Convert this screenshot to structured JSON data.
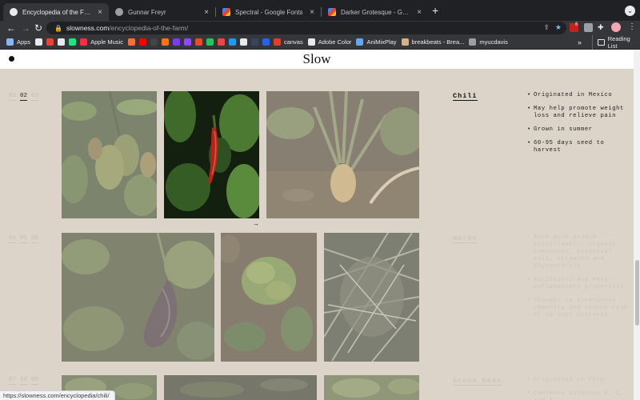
{
  "browser": {
    "tabs": [
      {
        "title": "Encyclopedia of the Farm – Slow",
        "favicon": "globe-icon",
        "active": true
      },
      {
        "title": "Gunnar Freyr",
        "favicon": "globe-icon",
        "active": false
      },
      {
        "title": "Spectral - Google Fonts",
        "favicon": "google-fonts-icon",
        "active": false
      },
      {
        "title": "Darker Grotesque - Google Fonts",
        "favicon": "google-fonts-icon",
        "active": false
      }
    ],
    "new_tab": "+",
    "url_host": "slowness.com",
    "url_path": "/encyclopedia-of-the-farm/",
    "extension_badge": "6",
    "bookmarks": [
      {
        "label": "Apps",
        "icon": "apps-grid-icon",
        "color": "#8ab4f8"
      },
      {
        "label": "",
        "icon": "google-icon",
        "color": "#e8eaed"
      },
      {
        "label": "",
        "icon": "gmail-icon",
        "color": "#ea4335"
      },
      {
        "label": "",
        "icon": "bookmark-icon",
        "color": "#e8eaed"
      },
      {
        "label": "",
        "icon": "hulu-icon",
        "color": "#1ce783"
      },
      {
        "label": "Apple Music",
        "icon": "apple-music-icon",
        "color": "#fa2d48"
      },
      {
        "label": "",
        "icon": "bookmark-icon",
        "color": "#ff6f3c"
      },
      {
        "label": "",
        "icon": "youtube-icon",
        "color": "#ff0000"
      },
      {
        "label": "",
        "icon": "bookmark-icon",
        "color": "#444"
      },
      {
        "label": "",
        "icon": "bookmark-icon",
        "color": "#f97316"
      },
      {
        "label": "",
        "icon": "bookmark-icon",
        "color": "#7c3aed"
      },
      {
        "label": "",
        "icon": "bookmark-icon",
        "color": "#9146ff"
      },
      {
        "label": "",
        "icon": "bookmark-icon",
        "color": "#e44d26"
      },
      {
        "label": "",
        "icon": "bookmark-icon",
        "color": "#22c55e"
      },
      {
        "label": "",
        "icon": "bookmark-icon",
        "color": "#ef4444"
      },
      {
        "label": "",
        "icon": "bookmark-icon",
        "color": "#1d9bf0"
      },
      {
        "label": "",
        "icon": "amazon-icon",
        "color": "#e8eaed"
      },
      {
        "label": "",
        "icon": "tumblr-icon",
        "color": "#36465d"
      },
      {
        "label": "",
        "icon": "bookmark-icon",
        "color": "#2563eb"
      },
      {
        "label": "canvas",
        "icon": "canvas-icon",
        "color": "#e13f2b"
      },
      {
        "label": "Adobe Color",
        "icon": "adobe-color-icon",
        "color": "#e8eaed"
      },
      {
        "label": "AniMixPlay",
        "icon": "play-icon",
        "color": "#5fa8ff"
      },
      {
        "label": "breakbeats - Brea...",
        "icon": "bookmark-icon",
        "color": "#d1b28a"
      },
      {
        "label": "myucdavis",
        "icon": "bookmark-icon",
        "color": "#9aa0a6"
      }
    ],
    "more_bookmarks": "»",
    "reading_list": "Reading List",
    "status_url": "https://slowness.com/encyclopedia/chili/"
  },
  "site": {
    "logo": "Slow"
  },
  "sections": [
    {
      "pager": [
        "01",
        "02",
        "03"
      ],
      "current_page": "02",
      "name": "Chili",
      "facts": [
        "Originated in Mexico",
        "May help promote weight loss and relieve pain",
        "Grown in summer",
        "60-95 days seed to harvest"
      ]
    },
    {
      "pager": [
        "04",
        "05",
        "06"
      ],
      "current_page": "",
      "name": "Herbs",
      "facts": [
        "Rich with unique antioxidants, organic compounds, essential oils, vitamins and phytosterols",
        "Antiseptic and anti-inflammatory properties",
        "Thought to strengthen immunity and reduce risk of various diseases"
      ]
    },
    {
      "pager": [
        "07",
        "08",
        "09"
      ],
      "current_page": "",
      "name": "Green Bean",
      "facts": [
        "Originated in Peru",
        "Contains vitamins K, C, and A"
      ]
    }
  ],
  "next_arrow": "→",
  "colors": {
    "page_bg": "#dcd4c9",
    "active_text": "#111111",
    "faded_text": "#cdc5b8"
  }
}
